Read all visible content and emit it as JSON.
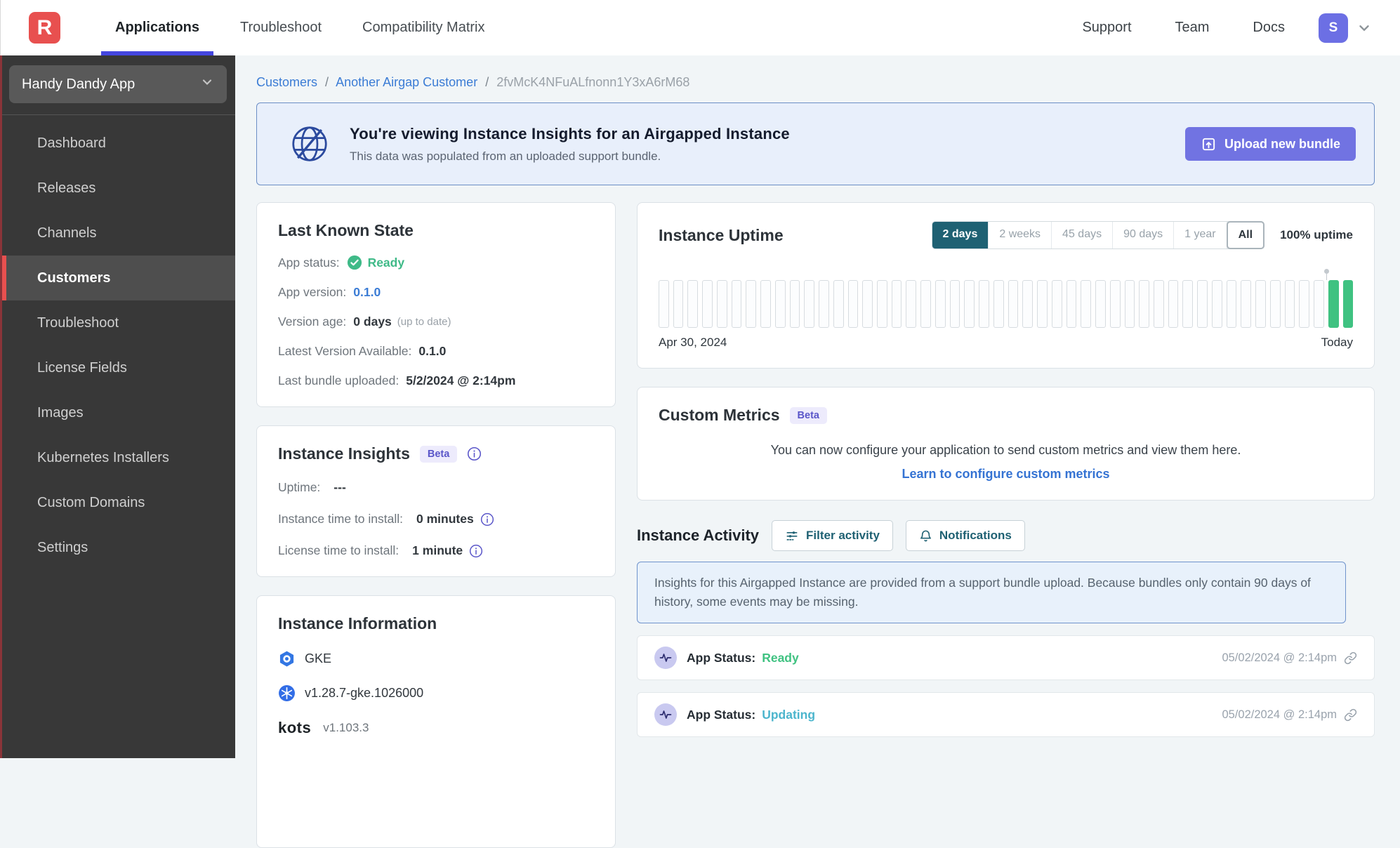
{
  "topnav": {
    "logo_letter": "R",
    "items": [
      {
        "label": "Applications",
        "active": true
      },
      {
        "label": "Troubleshoot",
        "active": false
      },
      {
        "label": "Compatibility Matrix",
        "active": false
      }
    ],
    "right_items": [
      {
        "label": "Support"
      },
      {
        "label": "Team"
      },
      {
        "label": "Docs"
      }
    ],
    "avatar_letter": "S"
  },
  "sidebar": {
    "app_selector": "Handy Dandy App",
    "items": [
      {
        "label": "Dashboard",
        "active": false
      },
      {
        "label": "Releases",
        "active": false
      },
      {
        "label": "Channels",
        "active": false
      },
      {
        "label": "Customers",
        "active": true
      },
      {
        "label": "Troubleshoot",
        "active": false
      },
      {
        "label": "License Fields",
        "active": false
      },
      {
        "label": "Images",
        "active": false
      },
      {
        "label": "Kubernetes Installers",
        "active": false
      },
      {
        "label": "Custom Domains",
        "active": false
      },
      {
        "label": "Settings",
        "active": false
      }
    ]
  },
  "breadcrumb": {
    "links": [
      "Customers",
      "Another Airgap Customer"
    ],
    "current": "2fvMcK4NFuALfnonn1Y3xA6rM68",
    "separator": "/"
  },
  "banner": {
    "title": "You're viewing Instance Insights for an Airgapped Instance",
    "subtitle": "This data was populated from an uploaded support bundle.",
    "button_label": "Upload new bundle"
  },
  "last_known_state": {
    "title": "Last Known State",
    "app_status_label": "App status:",
    "app_status_value": "Ready",
    "app_version_label": "App version:",
    "app_version_value": "0.1.0",
    "version_age_label": "Version age:",
    "version_age_value": "0 days",
    "version_age_note": "(up to date)",
    "latest_version_label": "Latest Version Available:",
    "latest_version_value": "0.1.0",
    "last_bundle_label": "Last bundle uploaded:",
    "last_bundle_value": "5/2/2024 @ 2:14pm"
  },
  "instance_insights": {
    "title": "Instance Insights",
    "beta": "Beta",
    "uptime_label": "Uptime:",
    "uptime_value": "---",
    "install_time_label": "Instance time to install:",
    "install_time_value": "0 minutes",
    "license_time_label": "License time to install:",
    "license_time_value": "1 minute"
  },
  "instance_information": {
    "title": "Instance Information",
    "distribution": "GKE",
    "k8s_version": "v1.28.7-gke.1026000",
    "kots_name": "kots",
    "kots_version": "v1.103.3"
  },
  "uptime": {
    "title": "Instance Uptime",
    "ranges": [
      "2 days",
      "2 weeks",
      "45 days",
      "90 days",
      "1 year",
      "All"
    ],
    "selected_range": "2 days",
    "uptime_text": "100% uptime",
    "start_label": "Apr 30, 2024",
    "end_label": "Today",
    "bar_count": 48,
    "up_count": 2,
    "up_color": "#3fc281"
  },
  "custom_metrics": {
    "title": "Custom Metrics",
    "beta": "Beta",
    "description": "You can now configure your application to send custom metrics and view them here.",
    "link_label": "Learn to configure custom metrics"
  },
  "instance_activity": {
    "title": "Instance Activity",
    "filter_label": "Filter activity",
    "notifications_label": "Notifications",
    "notice": "Insights for this Airgapped Instance are provided from a support bundle upload. Because bundles only contain 90 days of history, some events may be missing.",
    "events": [
      {
        "label": "App Status:",
        "value": "Ready",
        "status": "green",
        "timestamp": "05/02/2024 @ 2:14pm"
      },
      {
        "label": "App Status:",
        "value": "Updating",
        "status": "teal",
        "timestamp": "05/02/2024 @ 2:14pm"
      }
    ]
  },
  "colors": {
    "accent_red": "#e8504f",
    "nav_active_underline": "#4446df",
    "link_blue": "#3b7cd5",
    "button_purple": "#7173e2",
    "teal": "#1f6173",
    "green": "#3fc281",
    "badge_purple": "#5a56c9",
    "banner_bg": "#e8effb",
    "sidebar_bg": "#383838"
  }
}
